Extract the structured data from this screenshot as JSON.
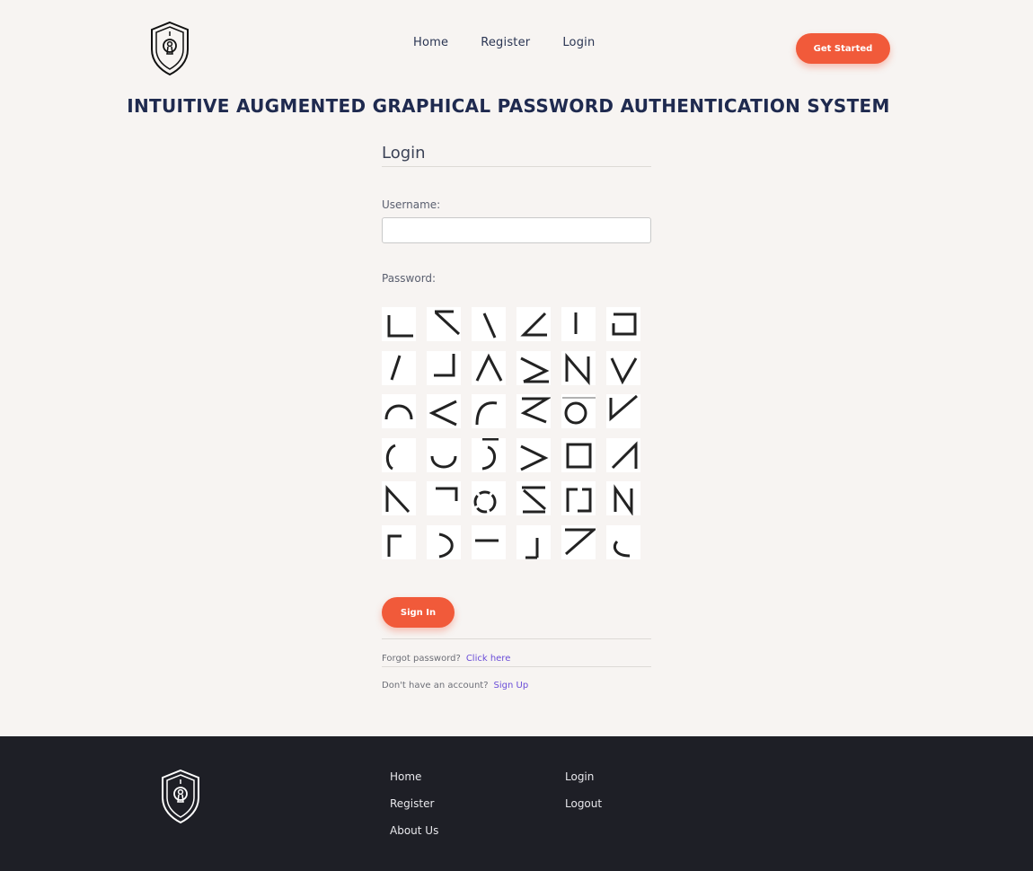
{
  "header": {
    "logo_icon": "shield-keyhole-icon",
    "nav": [
      "Home",
      "Register",
      "Login"
    ],
    "cta_label": "Get Started",
    "accent_color": "#f15a3a"
  },
  "hero": {
    "title": "INTUITIVE AUGMENTED GRAPHICAL PASSWORD AUTHENTICATION SYSTEM"
  },
  "login_form": {
    "title": "Login",
    "username_label": "Username:",
    "username_value": "",
    "password_label": "Password:",
    "password_tiles": [
      "corner-bottom-left",
      "slash-top",
      "backslash",
      "angle-bottom",
      "vertical-bar",
      "square-open-left",
      "slash",
      "corner-bottom-right",
      "caret-up",
      "sigma-angle",
      "letter-n",
      "letter-v",
      "arc-top",
      "less-than",
      "arc-top-left",
      "letter-z",
      "circle-open-top",
      "check-v",
      "arc-left",
      "arc-bottom",
      "hook-right",
      "greater-than",
      "square",
      "triangle-slash",
      "letter-n-slant",
      "corner-top-right",
      "circle-dashed",
      "letter-z-mirror",
      "bracket-square",
      "letter-n-reverse",
      "corner-top-left",
      "arc-right",
      "dash",
      "corner-bottom-right-low",
      "letter-z-top",
      "arc-bottom-left"
    ],
    "sign_in_label": "Sign In",
    "forgot_text": "Forgot password?",
    "forgot_link": "Click here",
    "no_account_text": "Don't have an account?",
    "signup_link": "Sign Up",
    "link_color": "#6a4dd8"
  },
  "footer": {
    "logo_icon": "shield-keyhole-icon",
    "col1": [
      "Home",
      "Register",
      "About Us"
    ],
    "col2": [
      "Login",
      "Logout"
    ],
    "background": "#1e1f26"
  }
}
